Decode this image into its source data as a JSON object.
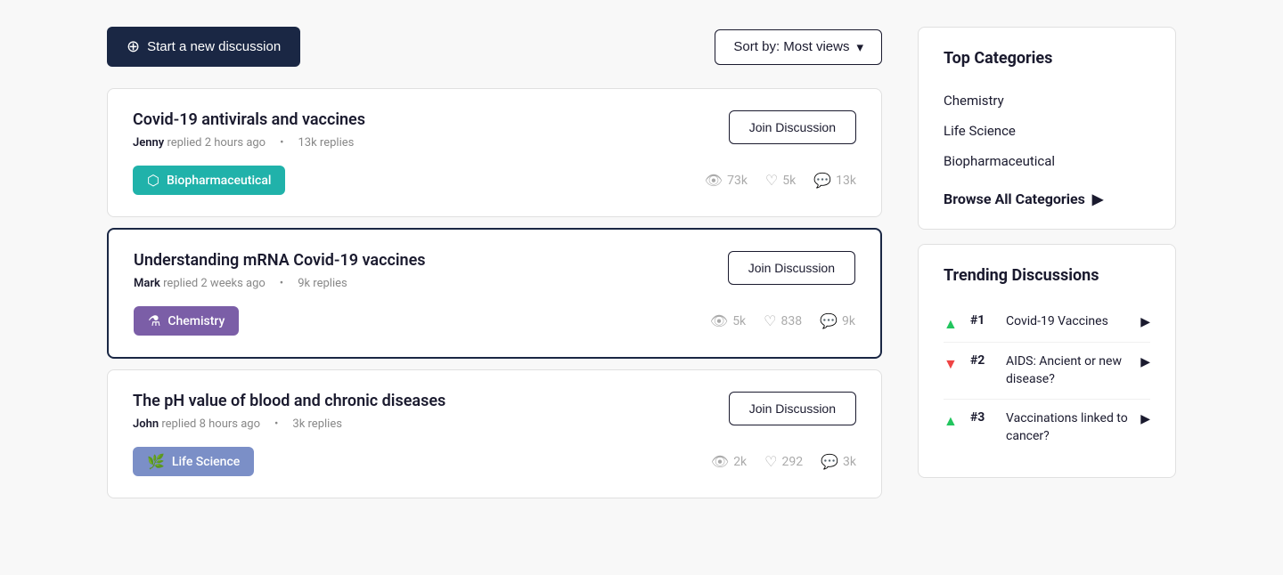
{
  "toolbar": {
    "start_label": "Start a new discussion",
    "sort_label": "Sort by: Most views",
    "sort_icon": "▾"
  },
  "discussions": [
    {
      "id": 1,
      "title": "Covid-19 antivirals and vaccines",
      "author": "Jenny",
      "time": "replied 2 hours ago",
      "replies": "13k replies",
      "join_label": "Join Discussion",
      "tag_label": "Biopharmaceutical",
      "tag_class": "biopharmaceutical",
      "tag_icon": "⬡",
      "views": "73k",
      "likes": "5k",
      "comments": "13k",
      "active_border": false
    },
    {
      "id": 2,
      "title": "Understanding mRNA Covid-19 vaccines",
      "author": "Mark",
      "time": "replied 2 weeks ago",
      "replies": "9k replies",
      "join_label": "Join Discussion",
      "tag_label": "Chemistry",
      "tag_class": "chemistry",
      "tag_icon": "⚗",
      "views": "5k",
      "likes": "838",
      "comments": "9k",
      "active_border": true
    },
    {
      "id": 3,
      "title": "The pH value of blood and chronic diseases",
      "author": "John",
      "time": "replied 8 hours ago",
      "replies": "3k replies",
      "join_label": "Join Discussion",
      "tag_label": "Life Science",
      "tag_class": "life-science",
      "tag_icon": "🌿",
      "views": "2k",
      "likes": "292",
      "comments": "3k",
      "active_border": false
    }
  ],
  "sidebar": {
    "top_categories_title": "Top Categories",
    "categories": [
      {
        "label": "Chemistry"
      },
      {
        "label": "Life Science"
      },
      {
        "label": "Biopharmaceutical"
      }
    ],
    "browse_label": "Browse All Categories",
    "browse_arrow": "▶",
    "trending_title": "Trending Discussions",
    "trending": [
      {
        "rank": "#1",
        "text": "Covid-19 Vaccines",
        "trend": "up"
      },
      {
        "rank": "#2",
        "text": "AIDS: Ancient or new disease?",
        "trend": "down"
      },
      {
        "rank": "#3",
        "text": "Vaccinations linked to cancer?",
        "trend": "up"
      }
    ]
  }
}
